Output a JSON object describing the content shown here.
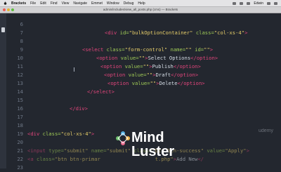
{
  "menubar": {
    "app_name": "Brackets",
    "items": [
      "File",
      "Edit",
      "Find",
      "View",
      "Navigate",
      "Emmet",
      "Window",
      "Debug",
      "Help"
    ],
    "user": "Edwin"
  },
  "window": {
    "title": "admin/includes/view_all_posts.php (cms) — Brackets"
  },
  "editor": {
    "lines": [
      {
        "num": "6",
        "tokens": []
      },
      {
        "num": "7",
        "tokens": [
          {
            "t": "<div ",
            "c": "tag"
          },
          {
            "t": "id=",
            "c": "attr"
          },
          {
            "t": "\"bulkOptionContainer\"",
            "c": "str"
          },
          {
            "t": " class=",
            "c": "attr"
          },
          {
            "t": "\"col-xs-4\"",
            "c": "str"
          },
          {
            "t": ">",
            "c": "tag"
          }
        ]
      },
      {
        "num": "8",
        "tokens": []
      },
      {
        "num": "9",
        "tokens": [
          {
            "t": "<select ",
            "c": "tag"
          },
          {
            "t": "class=",
            "c": "attr"
          },
          {
            "t": "\"form-control\"",
            "c": "str"
          },
          {
            "t": " name=",
            "c": "attr"
          },
          {
            "t": "\"\"",
            "c": "str"
          },
          {
            "t": " id=",
            "c": "attr"
          },
          {
            "t": "\"\"",
            "c": "str"
          },
          {
            "t": ">",
            "c": "tag"
          }
        ]
      },
      {
        "num": "10",
        "tokens": [
          {
            "t": "<option ",
            "c": "tag"
          },
          {
            "t": "value=",
            "c": "attr"
          },
          {
            "t": "\"\"",
            "c": "str"
          },
          {
            "t": ">",
            "c": "tag"
          },
          {
            "t": "Select Options",
            "c": "txt"
          },
          {
            "t": "</option>",
            "c": "tag"
          }
        ]
      },
      {
        "num": "11",
        "tokens": [
          {
            "t": "<option ",
            "c": "tag"
          },
          {
            "t": "value=",
            "c": "attr"
          },
          {
            "t": "\"\"",
            "c": "str"
          },
          {
            "t": ">",
            "c": "tag"
          },
          {
            "t": "Publish",
            "c": "txt"
          },
          {
            "t": "</option>",
            "c": "tag"
          }
        ]
      },
      {
        "num": "12",
        "tokens": [
          {
            "t": "<option ",
            "c": "tag"
          },
          {
            "t": "value=",
            "c": "attr"
          },
          {
            "t": "\"\"",
            "c": "str"
          },
          {
            "t": ">",
            "c": "tag"
          },
          {
            "t": "Draft",
            "c": "txt"
          },
          {
            "t": "</option>",
            "c": "tag"
          }
        ]
      },
      {
        "num": "13",
        "tokens": [
          {
            "t": "<option ",
            "c": "tag"
          },
          {
            "t": "value=",
            "c": "attr"
          },
          {
            "t": "\"\"",
            "c": "str"
          },
          {
            "t": ">",
            "c": "tag"
          },
          {
            "t": "Delete",
            "c": "txt"
          },
          {
            "t": "</option>",
            "c": "tag"
          }
        ]
      },
      {
        "num": "14",
        "tokens": [
          {
            "t": "</select>",
            "c": "tag"
          }
        ]
      },
      {
        "num": "15",
        "tokens": []
      },
      {
        "num": "16",
        "tokens": [
          {
            "t": "</div>",
            "c": "tag"
          }
        ]
      },
      {
        "num": "17",
        "tokens": []
      },
      {
        "num": "18",
        "tokens": []
      },
      {
        "num": "19",
        "tokens": [
          {
            "t": "<div ",
            "c": "tag"
          },
          {
            "t": "class=",
            "c": "attr"
          },
          {
            "t": "\"col-xs-4\"",
            "c": "str"
          },
          {
            "t": ">",
            "c": "tag"
          }
        ]
      },
      {
        "num": "20",
        "tokens": []
      },
      {
        "num": "21",
        "dim": true,
        "tokens": [
          {
            "t": "<input ",
            "c": "tag"
          },
          {
            "t": "type=",
            "c": "attr"
          },
          {
            "t": "\"submit\"",
            "c": "str"
          },
          {
            "t": " name=",
            "c": "attr"
          },
          {
            "t": "\"submit\"",
            "c": "str"
          },
          {
            "t": " class=",
            "c": "attr"
          },
          {
            "t": "\"btn btn-success\"",
            "c": "str"
          },
          {
            "t": " value=",
            "c": "attr"
          },
          {
            "t": "\"Apply\"",
            "c": "str"
          },
          {
            "t": ">",
            "c": "tag"
          }
        ]
      },
      {
        "num": "22",
        "dim": true,
        "tokens": [
          {
            "t": "<a ",
            "c": "tag"
          },
          {
            "t": "class=",
            "c": "attr"
          },
          {
            "t": "\"btn btn-primar",
            "c": "str"
          },
          {
            "t": "                  ",
            "c": "txt"
          },
          {
            "t": "t.php\"",
            "c": "str"
          },
          {
            "t": ">",
            "c": "tag"
          },
          {
            "t": "Add New",
            "c": "txt"
          },
          {
            "t": "</",
            "c": "tag"
          }
        ]
      },
      {
        "num": "23",
        "tokens": []
      }
    ]
  },
  "watermark": {
    "brand_line1": "Mind",
    "brand_line2": "Luster",
    "udemy": "udemy"
  },
  "colors": {
    "background": "#23272f",
    "tag": "#e0457b",
    "attr": "#9fca56",
    "string": "#e6cd69",
    "text": "#d6dde6",
    "line_number": "#6f7887"
  }
}
